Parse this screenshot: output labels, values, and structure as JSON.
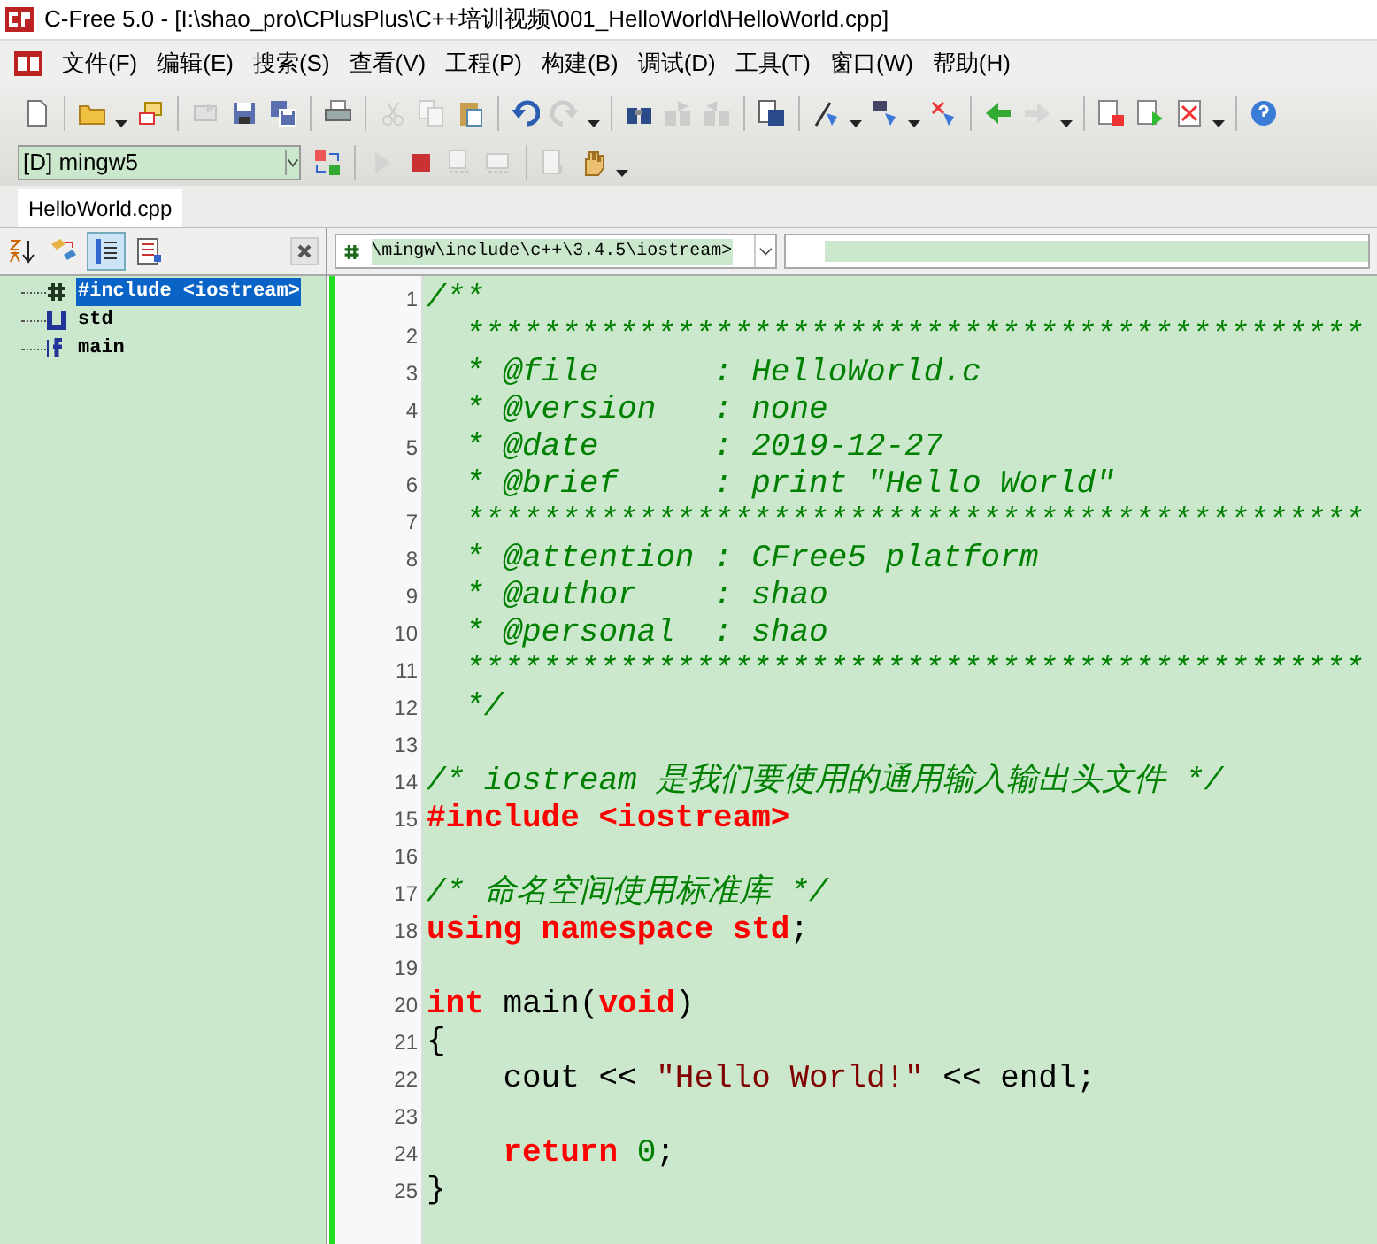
{
  "window": {
    "title": "C-Free 5.0 - [I:\\shao_pro\\CPlusPlus\\C++培训视频\\001_HelloWorld\\HelloWorld.cpp]"
  },
  "menu": [
    "文件(F)",
    "编辑(E)",
    "搜索(S)",
    "查看(V)",
    "工程(P)",
    "构建(B)",
    "调试(D)",
    "工具(T)",
    "窗口(W)",
    "帮助(H)"
  ],
  "toolbar": [
    {
      "kind": "button",
      "disabled": false
    },
    {
      "kind": "separator"
    },
    {
      "kind": "button",
      "disabled": false
    },
    {
      "kind": "dropdown"
    },
    {
      "kind": "button",
      "disabled": false
    },
    {
      "kind": "separator"
    },
    {
      "kind": "button",
      "disabled": true
    },
    {
      "kind": "button",
      "disabled": false
    },
    {
      "kind": "button",
      "disabled": false
    },
    {
      "kind": "separator"
    },
    {
      "kind": "button",
      "disabled": false
    },
    {
      "kind": "separator"
    },
    {
      "kind": "button",
      "disabled": true
    },
    {
      "kind": "button",
      "disabled": true
    },
    {
      "kind": "button",
      "disabled": false
    },
    {
      "kind": "separator"
    },
    {
      "kind": "button",
      "disabled": false
    },
    {
      "kind": "button",
      "disabled": true
    },
    {
      "kind": "dropdown"
    },
    {
      "kind": "separator"
    },
    {
      "kind": "button",
      "disabled": false
    },
    {
      "kind": "button",
      "disabled": true
    },
    {
      "kind": "button",
      "disabled": true
    },
    {
      "kind": "separator"
    },
    {
      "kind": "button",
      "disabled": false
    },
    {
      "kind": "separator"
    },
    {
      "kind": "button",
      "disabled": false
    },
    {
      "kind": "dropdown"
    },
    {
      "kind": "button",
      "disabled": false
    },
    {
      "kind": "dropdown"
    },
    {
      "kind": "button",
      "disabled": false
    },
    {
      "kind": "separator"
    },
    {
      "kind": "button",
      "disabled": false
    },
    {
      "kind": "button",
      "disabled": true
    },
    {
      "kind": "dropdown"
    },
    {
      "kind": "separator"
    },
    {
      "kind": "button",
      "disabled": false
    },
    {
      "kind": "button",
      "disabled": false
    },
    {
      "kind": "button",
      "disabled": false
    },
    {
      "kind": "dropdown"
    },
    {
      "kind": "separator"
    },
    {
      "kind": "button",
      "disabled": false
    }
  ],
  "build_bar": {
    "compiler": "[D] mingw5",
    "buttons": [
      {
        "kind": "button",
        "disabled": false
      },
      {
        "kind": "separator"
      },
      {
        "kind": "button",
        "disabled": true
      },
      {
        "kind": "button",
        "disabled": false
      },
      {
        "kind": "button",
        "disabled": true
      },
      {
        "kind": "button",
        "disabled": true
      },
      {
        "kind": "separator"
      },
      {
        "kind": "button",
        "disabled": true
      },
      {
        "kind": "button",
        "disabled": false
      },
      {
        "kind": "dropdown"
      }
    ]
  },
  "tabs": [
    {
      "label": "HelloWorld.cpp",
      "selected": true
    }
  ],
  "outline": {
    "tools": [
      {
        "selected": false
      },
      {
        "selected": false
      },
      {
        "selected": true
      },
      {
        "selected": false
      }
    ],
    "items": [
      {
        "kind": "include",
        "label": "#include <iostream>",
        "selected": true
      },
      {
        "kind": "namespace",
        "label": "std",
        "selected": false
      },
      {
        "kind": "function",
        "label": "main",
        "selected": false
      }
    ]
  },
  "editor": {
    "include_path": "\\mingw\\include\\c++\\3.4.5\\iostream>",
    "lines": [
      {
        "number": "1",
        "tokens": [
          {
            "kind": "comment",
            "text": "/**"
          }
        ]
      },
      {
        "number": "2",
        "tokens": [
          {
            "kind": "comment",
            "text": "  ***********************************************"
          }
        ]
      },
      {
        "number": "3",
        "tokens": [
          {
            "kind": "comment",
            "text": "  * @file      : HelloWorld.c"
          }
        ]
      },
      {
        "number": "4",
        "tokens": [
          {
            "kind": "comment",
            "text": "  * @version   : none"
          }
        ]
      },
      {
        "number": "5",
        "tokens": [
          {
            "kind": "comment",
            "text": "  * @date      : 2019-12-27"
          }
        ]
      },
      {
        "number": "6",
        "tokens": [
          {
            "kind": "comment",
            "text": "  * @brief     : print \"Hello World\""
          }
        ]
      },
      {
        "number": "7",
        "tokens": [
          {
            "kind": "comment",
            "text": "  ***********************************************"
          }
        ]
      },
      {
        "number": "8",
        "tokens": [
          {
            "kind": "comment",
            "text": "  * @attention : CFree5 platform"
          }
        ]
      },
      {
        "number": "9",
        "tokens": [
          {
            "kind": "comment",
            "text": "  * @author    : shao"
          }
        ]
      },
      {
        "number": "10",
        "tokens": [
          {
            "kind": "comment",
            "text": "  * @personal  : shao"
          }
        ]
      },
      {
        "number": "11",
        "tokens": [
          {
            "kind": "comment",
            "text": "  ***********************************************"
          }
        ]
      },
      {
        "number": "12",
        "tokens": [
          {
            "kind": "comment",
            "text": "  */"
          }
        ]
      },
      {
        "number": "13"
      },
      {
        "number": "14",
        "tokens": [
          {
            "kind": "comment",
            "text": "/* iostream 是我们要使用的通用输入输出头文件 */"
          }
        ]
      },
      {
        "number": "15",
        "tokens": [
          {
            "kind": "keyword",
            "text": "#include <iostream>"
          }
        ]
      },
      {
        "number": "16"
      },
      {
        "number": "17",
        "tokens": [
          {
            "kind": "comment",
            "text": "/* 命名空间使用标准库 */"
          }
        ]
      },
      {
        "number": "18",
        "tokens": [
          {
            "kind": "keyword",
            "text": "using namespace std"
          },
          {
            "kind": "plain",
            "text": ";"
          }
        ]
      },
      {
        "number": "19"
      },
      {
        "number": "20",
        "tokens": [
          {
            "kind": "keyword",
            "text": "int"
          },
          {
            "kind": "plain",
            "text": " main("
          },
          {
            "kind": "keyword",
            "text": "void"
          },
          {
            "kind": "plain",
            "text": ")"
          }
        ]
      },
      {
        "number": "21",
        "tokens": [
          {
            "kind": "plain",
            "text": "{"
          }
        ]
      },
      {
        "number": "22",
        "tokens": [
          {
            "kind": "plain",
            "text": "    cout << "
          },
          {
            "kind": "string",
            "text": "\"Hello World!\""
          },
          {
            "kind": "plain",
            "text": " << endl;"
          }
        ]
      },
      {
        "number": "23"
      },
      {
        "number": "24",
        "tokens": [
          {
            "kind": "keyword",
            "text": "    return"
          },
          {
            "kind": "number",
            "text": " 0"
          },
          {
            "kind": "plain",
            "text": ";"
          }
        ]
      },
      {
        "number": "25",
        "tokens": [
          {
            "kind": "plain",
            "text": "}"
          }
        ]
      }
    ]
  }
}
